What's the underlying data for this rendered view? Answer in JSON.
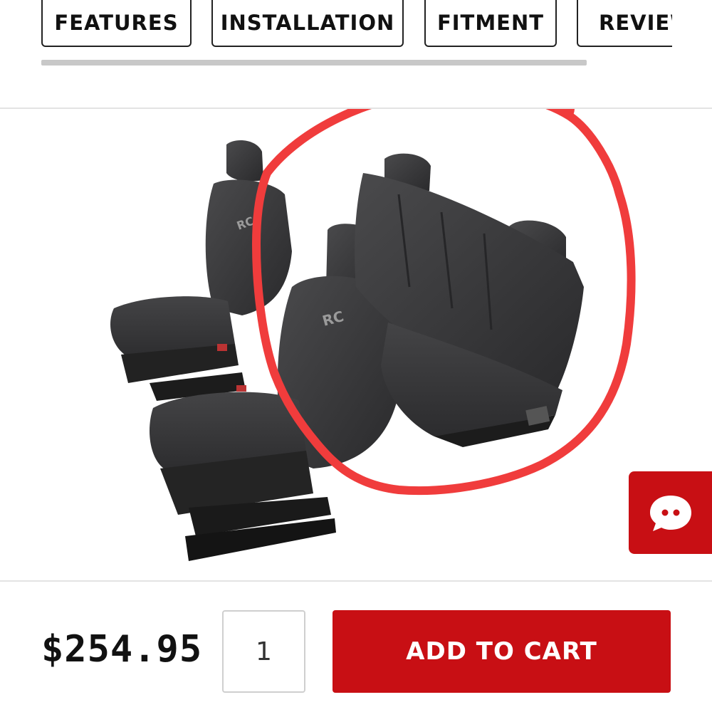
{
  "tabs": [
    {
      "label": "FEATURES"
    },
    {
      "label": "INSTALLATION"
    },
    {
      "label": "FITMENT"
    },
    {
      "label": "REVIEW"
    }
  ],
  "product": {
    "image_description_icon": "seat-covers-icon",
    "logo_text": "RC",
    "highlight_color": "#f03c3c"
  },
  "purchase": {
    "price": "$254.95",
    "quantity": "1",
    "add_to_cart_label": "ADD TO CART"
  },
  "colors": {
    "accent": "#c80f14",
    "text": "#111111"
  },
  "chat": {
    "icon": "chat-bubble-icon"
  }
}
